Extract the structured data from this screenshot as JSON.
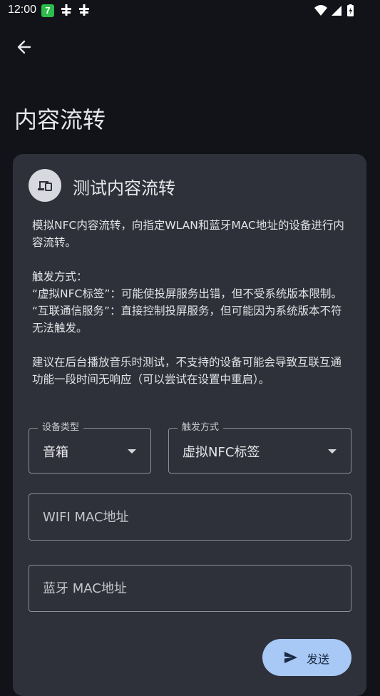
{
  "status_bar": {
    "time": "12:00",
    "badge": "7"
  },
  "page": {
    "title": "内容流转"
  },
  "card": {
    "title": "测试内容流转",
    "description": [
      "模拟NFC内容流转，向指定WLAN和蓝牙MAC地址的设备进行内容流转。",
      "",
      "触发方式：",
      "“虚拟NFC标签”：可能使投屏服务出错，但不受系统版本限制。",
      "“互联通信服务”：直接控制投屏服务，但可能因为系统版本不符无法触发。",
      "",
      "建议在后台播放音乐时测试，不支持的设备可能会导致互联互通功能一段时间无响应（可以尝试在设置中重启）。"
    ],
    "device_type": {
      "label": "设备类型",
      "value": "音箱"
    },
    "trigger_mode": {
      "label": "触发方式",
      "value": "虚拟NFC标签"
    },
    "wifi_mac": {
      "placeholder": "WIFI MAC地址",
      "value": ""
    },
    "bt_mac": {
      "placeholder": "蓝牙 MAC地址",
      "value": ""
    },
    "send_label": "发送"
  },
  "colors": {
    "background": "#111318",
    "card": "#2e3139",
    "accent_button": "#a8c8f5"
  }
}
